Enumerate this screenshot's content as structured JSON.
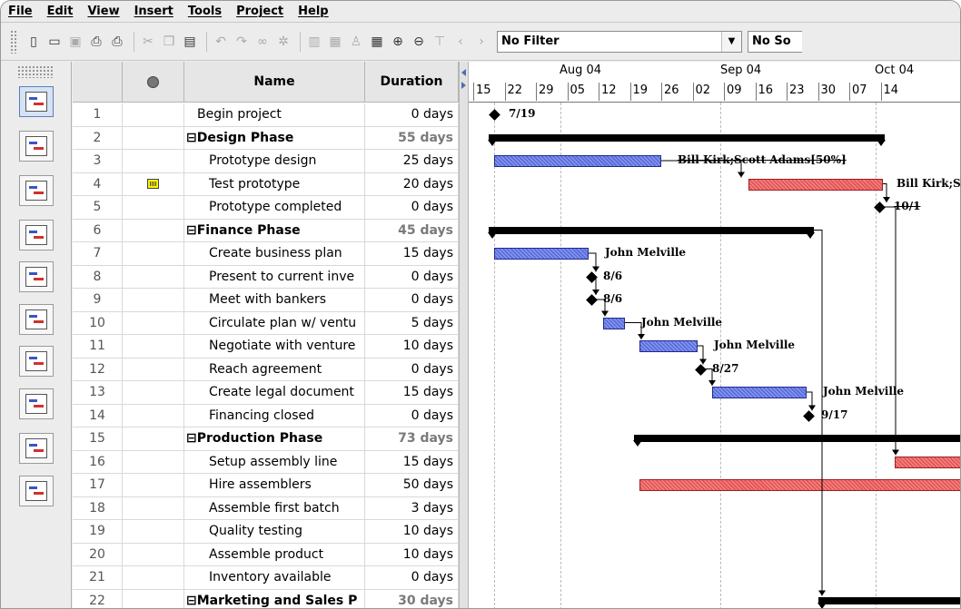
{
  "menu": [
    {
      "label": "File"
    },
    {
      "label": "Edit"
    },
    {
      "label": "View"
    },
    {
      "label": "Insert"
    },
    {
      "label": "Tools"
    },
    {
      "label": "Project"
    },
    {
      "label": "Help"
    }
  ],
  "toolbar": {
    "filter_value": "No Filter",
    "sort_value": "No So"
  },
  "columns": {
    "indicator_icon": "info-icon",
    "name": "Name",
    "duration": "Duration"
  },
  "rows": [
    {
      "id": "1",
      "name": "Begin project",
      "duration": "0 days",
      "type": "milestone-top"
    },
    {
      "id": "2",
      "name": "⊟Design Phase",
      "duration": "55 days",
      "type": "summary"
    },
    {
      "id": "3",
      "name": "Prototype design",
      "duration": "25 days",
      "type": "task"
    },
    {
      "id": "4",
      "name": "Test prototype",
      "duration": "20 days",
      "type": "task",
      "indicator": "calendar-icon"
    },
    {
      "id": "5",
      "name": "Prototype completed",
      "duration": "0 days",
      "type": "task"
    },
    {
      "id": "6",
      "name": "⊟Finance Phase",
      "duration": "45 days",
      "type": "summary"
    },
    {
      "id": "7",
      "name": "Create business plan",
      "duration": "15 days",
      "type": "task"
    },
    {
      "id": "8",
      "name": "Present to current inve",
      "duration": "0 days",
      "type": "task"
    },
    {
      "id": "9",
      "name": "Meet with bankers",
      "duration": "0 days",
      "type": "task"
    },
    {
      "id": "10",
      "name": "Circulate plan w/ ventu",
      "duration": "5 days",
      "type": "task"
    },
    {
      "id": "11",
      "name": "Negotiate with venture",
      "duration": "10 days",
      "type": "task"
    },
    {
      "id": "12",
      "name": "Reach agreement",
      "duration": "0 days",
      "type": "task"
    },
    {
      "id": "13",
      "name": "Create legal document",
      "duration": "15 days",
      "type": "task"
    },
    {
      "id": "14",
      "name": "Financing closed",
      "duration": "0 days",
      "type": "task"
    },
    {
      "id": "15",
      "name": "⊟Production Phase",
      "duration": "73 days",
      "type": "summary"
    },
    {
      "id": "16",
      "name": "Setup assembly line",
      "duration": "15 days",
      "type": "task"
    },
    {
      "id": "17",
      "name": "Hire assemblers",
      "duration": "50 days",
      "type": "task"
    },
    {
      "id": "18",
      "name": "Assemble first batch",
      "duration": "3 days",
      "type": "task"
    },
    {
      "id": "19",
      "name": "Quality testing",
      "duration": "10 days",
      "type": "task"
    },
    {
      "id": "20",
      "name": "Assemble product",
      "duration": "10 days",
      "type": "task"
    },
    {
      "id": "21",
      "name": "Inventory available",
      "duration": "0 days",
      "type": "task"
    },
    {
      "id": "22",
      "name": "⊟Marketing and Sales P",
      "duration": "30 days",
      "type": "summary"
    }
  ],
  "gantt": {
    "months": [
      {
        "label": "Aug 04"
      },
      {
        "label": "Sep 04"
      },
      {
        "label": "Oct 04"
      }
    ],
    "days": [
      {
        "label": "15"
      },
      {
        "label": "22"
      },
      {
        "label": "29"
      },
      {
        "label": "05"
      },
      {
        "label": "12"
      },
      {
        "label": "19"
      },
      {
        "label": "26"
      },
      {
        "label": "02"
      },
      {
        "label": "09"
      },
      {
        "label": "16"
      },
      {
        "label": "23"
      },
      {
        "label": "30"
      },
      {
        "label": "07"
      },
      {
        "label": "14"
      }
    ],
    "labels": {
      "m1": "7/19",
      "r3": "Bill Kirk;Scott Adams[50%]",
      "r4": "Bill Kirk;S",
      "m5": "10/1",
      "r7": "John Melville",
      "m8": "8/6",
      "m9": "8/6",
      "r10": "John Melville",
      "r11": "John Melville",
      "m12": "8/27",
      "r13": "John Melville",
      "m14": "9/17"
    },
    "colors": {
      "task_blue": "#5a6ee0",
      "task_red": "#e85656",
      "summary": "#000000"
    }
  },
  "views": [
    {
      "icon": "gantt-view-icon"
    },
    {
      "icon": "tracking-gantt-icon"
    },
    {
      "icon": "network-diagram-icon"
    },
    {
      "icon": "resource-sheet-icon"
    },
    {
      "icon": "task-usage-icon"
    },
    {
      "icon": "wbs-chart-icon"
    },
    {
      "icon": "resource-wbs-icon"
    },
    {
      "icon": "task-sheet-icon"
    },
    {
      "icon": "report-icon"
    },
    {
      "icon": "resource-usage-icon"
    }
  ]
}
